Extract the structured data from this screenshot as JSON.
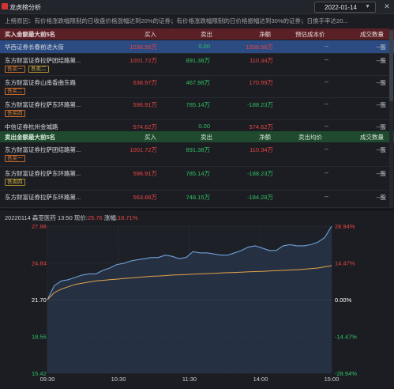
{
  "window": {
    "title": "龙虎榜分析",
    "date": "2022-01-14"
  },
  "reason": "上榜原因：有价格涨跌幅限制的日收盘价格涨幅达到20%的证券；有价格涨跌幅限制的日价格振幅达到30%的证券；日换手率达20...",
  "buy_section": {
    "headers": [
      "买入金额最大前5名",
      "买入",
      "卖出",
      "净额",
      "预估成本价",
      "成交数量"
    ],
    "rows": [
      {
        "name": "华西证券长春前进大街",
        "buy": "1036.56万",
        "sell": "0.00",
        "net": "1036.56万",
        "net_sign": "pos",
        "avg": "--",
        "vol": "--股",
        "tags": [],
        "selected": true
      },
      {
        "name": "东方财富证券拉萨团结路第...",
        "buy": "1001.72万",
        "sell": "891.38万",
        "net": "110.34万",
        "net_sign": "pos",
        "avg": "--",
        "vol": "--股",
        "tags": [
          "吾买一",
          "吾卖二"
        ],
        "selected": false
      },
      {
        "name": "东方财富证券山南香曲东路",
        "buy": "638.97万",
        "sell": "467.98万",
        "net": "170.99万",
        "net_sign": "pos",
        "avg": "--",
        "vol": "--股",
        "tags": [
          "吾买二"
        ],
        "selected": false
      },
      {
        "name": "东方财富证券拉萨东环路第...",
        "buy": "596.91万",
        "sell": "785.14万",
        "net": "-188.23万",
        "net_sign": "neg",
        "avg": "--",
        "vol": "--股",
        "tags": [
          "吾买四"
        ],
        "selected": false
      },
      {
        "name": "中信证券杭州金城路",
        "buy": "574.62万",
        "sell": "0.00",
        "net": "574.62万",
        "net_sign": "pos",
        "avg": "--",
        "vol": "--股",
        "tags": [],
        "selected": false
      }
    ]
  },
  "sell_section": {
    "headers": [
      "卖出金额最大前5名",
      "买入",
      "卖出",
      "净额",
      "卖出均价",
      "成交数量"
    ],
    "rows": [
      {
        "name": "东方财富证券拉萨团结路第...",
        "buy": "1001.72万",
        "sell": "891.38万",
        "net": "110.34万",
        "net_sign": "pos",
        "avg": "--",
        "vol": "--股",
        "tags": [
          "吾买一"
        ]
      },
      {
        "name": "东方财富证券拉萨东环路第...",
        "buy": "596.91万",
        "sell": "785.14万",
        "net": "-188.23万",
        "net_sign": "neg",
        "avg": "--",
        "vol": "--股",
        "tags": [
          "吾卖四"
        ]
      },
      {
        "name": "东方财富证券拉萨东环路第...",
        "buy": "563.88万",
        "sell": "748.15万",
        "net": "-184.28万",
        "net_sign": "neg",
        "avg": "--",
        "vol": "--股",
        "tags": []
      }
    ]
  },
  "chart_info": {
    "date": "20220114",
    "stock": "森亚医药",
    "time": "13:50",
    "price_label": "现价:",
    "price": "25.76",
    "change_label": "涨幅:",
    "change": "18.71%"
  },
  "chart_data": {
    "type": "line",
    "y_left_ticks": [
      "27.98",
      "24.84",
      "21.70",
      "18.56",
      "15.42"
    ],
    "y_right_ticks": [
      "28.94%",
      "14.47%",
      "0.00%",
      "-14.47%",
      "-28.94%"
    ],
    "x_ticks": [
      "09:30",
      "10:30",
      "11:30",
      "14:00",
      "15:00"
    ],
    "ylim": [
      15.42,
      27.98
    ],
    "series": [
      {
        "name": "",
        "color": "#6f9fd8",
        "values": [
          21.7,
          22.9,
          23.3,
          23.4,
          23.6,
          23.8,
          23.9,
          23.9,
          24.2,
          24.4,
          24.7,
          24.8,
          25.0,
          25.1,
          25.2,
          25.3,
          25.3,
          25.5,
          25.4,
          25.2,
          25.3,
          25.8,
          25.7,
          25.7,
          25.6,
          25.5,
          25.5,
          25.7,
          25.9,
          26.2,
          26.3,
          26.1,
          25.9,
          25.9,
          26.3,
          26.4,
          26.3,
          26.3,
          26.4,
          26.6,
          27.0,
          27.98
        ]
      },
      {
        "name": "",
        "color": "#e6a34a",
        "values": [
          21.7,
          22.3,
          22.6,
          22.8,
          23.0,
          23.1,
          23.2,
          23.3,
          23.35,
          23.4,
          23.45,
          23.5,
          23.55,
          23.6,
          23.65,
          23.7,
          23.72,
          23.75,
          23.8,
          23.82,
          23.85,
          23.88,
          23.9,
          23.93,
          23.95,
          23.98,
          24.0,
          24.02,
          24.05,
          24.08,
          24.1,
          24.12,
          24.15,
          24.18,
          24.2,
          24.23,
          24.26,
          24.3,
          24.35,
          24.4,
          24.5,
          24.6
        ]
      }
    ],
    "colors": {
      "up": "#e84545",
      "down": "#30c063",
      "base": "#ffffff"
    }
  }
}
